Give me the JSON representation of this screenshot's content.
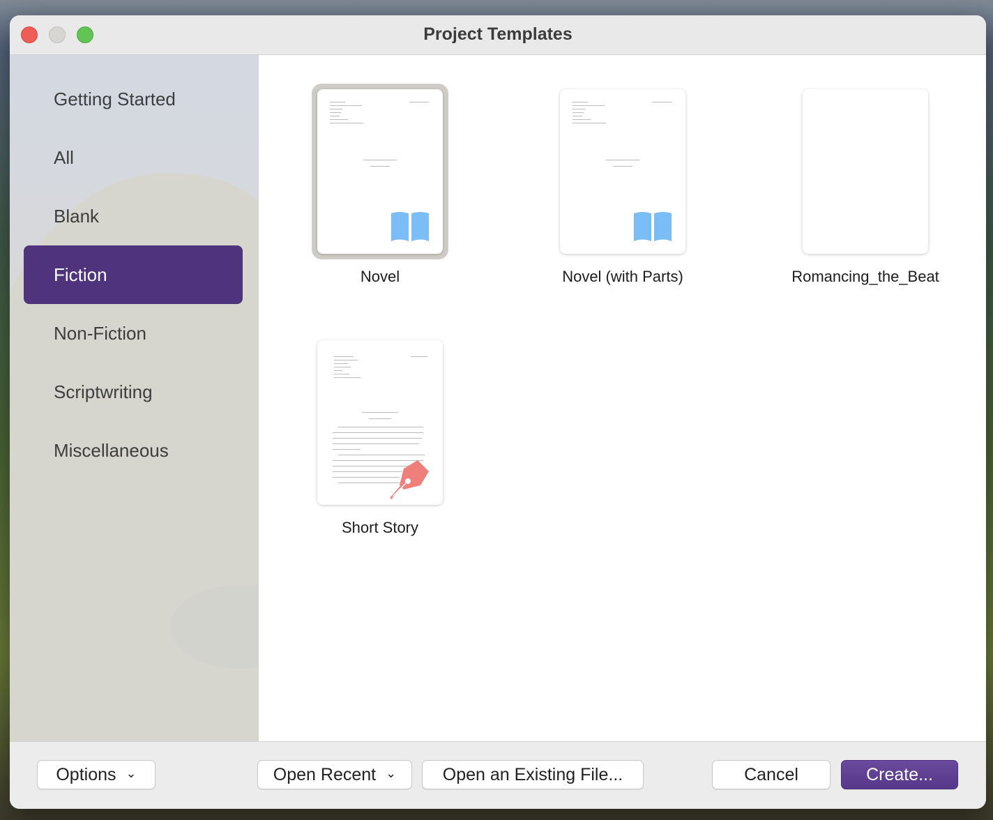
{
  "window": {
    "title": "Project Templates"
  },
  "sidebar": {
    "items": [
      {
        "label": "Getting Started",
        "selected": false
      },
      {
        "label": "All",
        "selected": false
      },
      {
        "label": "Blank",
        "selected": false
      },
      {
        "label": "Fiction",
        "selected": true
      },
      {
        "label": "Non-Fiction",
        "selected": false
      },
      {
        "label": "Scriptwriting",
        "selected": false
      },
      {
        "label": "Miscellaneous",
        "selected": false
      }
    ]
  },
  "templates": [
    {
      "label": "Novel",
      "selected": true,
      "icon": "book-icon"
    },
    {
      "label": "Novel (with Parts)",
      "selected": false,
      "icon": "book-icon"
    },
    {
      "label": "Romancing_the_Beat",
      "selected": false,
      "icon": ""
    },
    {
      "label": "Short Story",
      "selected": false,
      "icon": "pen-nib-icon"
    }
  ],
  "footer": {
    "options_label": "Options",
    "open_recent_label": "Open Recent",
    "open_existing_label": "Open an Existing File...",
    "cancel_label": "Cancel",
    "create_label": "Create..."
  },
  "colors": {
    "accent": "#4f337c",
    "book_icon": "#7abdf7",
    "pen_icon": "#ee7f7a"
  }
}
